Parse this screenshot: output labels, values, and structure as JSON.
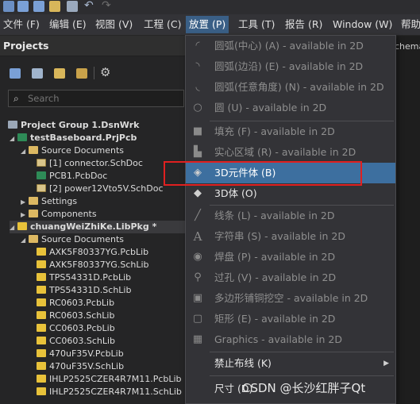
{
  "menubar": {
    "items": [
      "文件 (F)",
      "编辑 (E)",
      "视图 (V)",
      "工程 (C)",
      "放置 (P)",
      "工具 (T)",
      "报告 (R)",
      "Window (W)",
      "帮助"
    ]
  },
  "panel": {
    "title": "Projects",
    "search_placeholder": "Search",
    "tree": [
      {
        "label": "Project Group 1.DsnWrk",
        "bold": true
      },
      {
        "label": "testBaseboard.PrjPcb",
        "bold": true
      },
      {
        "label": "Source Documents"
      },
      {
        "label": "[1] connector.SchDoc"
      },
      {
        "label": "PCB1.PcbDoc"
      },
      {
        "label": "[2] power12Vto5V.SchDoc"
      },
      {
        "label": "Settings"
      },
      {
        "label": "Components"
      },
      {
        "label": "chuangWeiZhiKe.LibPkg *",
        "bold": true
      },
      {
        "label": "Source Documents"
      },
      {
        "label": "AXK5F80337YG.PcbLib"
      },
      {
        "label": "AXK5F80337YG.SchLib"
      },
      {
        "label": "TPS54331D.PcbLib"
      },
      {
        "label": "TPS54331D.SchLib"
      },
      {
        "label": "RC0603.PcbLib"
      },
      {
        "label": "RC0603.SchLib"
      },
      {
        "label": "CC0603.PcbLib"
      },
      {
        "label": "CC0603.SchLib"
      },
      {
        "label": "470uF35V.PcbLib"
      },
      {
        "label": "470uF35V.SchLib"
      },
      {
        "label": "IHLP2525CZER4R7M11.PcbLib"
      },
      {
        "label": "IHLP2525CZER4R7M11.SchLib"
      }
    ]
  },
  "right_tab_hint": "chema",
  "dropdown": {
    "items": [
      {
        "label": "圆弧(中心) (A) - available in 2D",
        "icon": "arc-center-icon"
      },
      {
        "label": "圆弧(边沿) (E) - available in 2D",
        "icon": "arc-edge-icon"
      },
      {
        "label": "圆弧(任意角度) (N) - available in 2D",
        "icon": "arc-any-angle-icon"
      },
      {
        "label": "圆 (U) - available in 2D",
        "icon": "circle-icon"
      },
      {
        "label": "填充 (F) - available in 2D",
        "icon": "fill-icon"
      },
      {
        "label": "实心区域 (R) - available in 2D",
        "icon": "solid-region-icon"
      },
      {
        "label": "3D元件体 (B)",
        "icon": "3d-body-icon"
      },
      {
        "label": "3D体 (O)",
        "icon": "3d-icon"
      },
      {
        "label": "线条 (L) - available in 2D",
        "icon": "line-icon"
      },
      {
        "label": "字符串 (S) - available in 2D",
        "icon": "string-icon"
      },
      {
        "label": "焊盘 (P) - available in 2D",
        "icon": "pad-icon"
      },
      {
        "label": "过孔 (V) - available in 2D",
        "icon": "via-icon"
      },
      {
        "label": "多边形铺铜挖空 - available in 2D",
        "icon": "polygon-cutout-icon"
      },
      {
        "label": "矩形 (E) - available in 2D",
        "icon": "rectangle-icon"
      },
      {
        "label": "Graphics - available in 2D",
        "icon": "graphics-icon"
      },
      {
        "label": "禁止布线 (K)",
        "icon": ""
      },
      {
        "label": "尺寸 (D)",
        "icon": ""
      }
    ]
  },
  "watermark": "CSDN @长沙红胖子Qt"
}
